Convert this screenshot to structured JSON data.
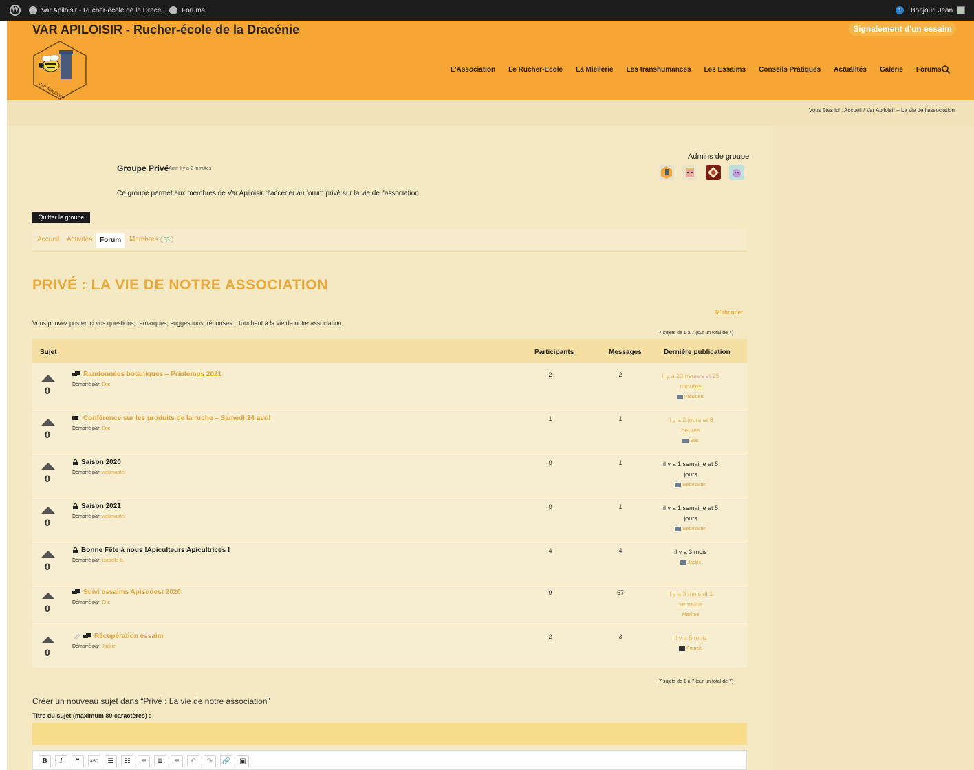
{
  "adminbar": {
    "site_name": "Var Apiloisir - Rucher-école de la Dracé...",
    "forums": "Forums",
    "notifications": "1",
    "greeting": "Bonjour, Jean"
  },
  "site": {
    "title": "VAR APILOISIR - Rucher-école de la Dracénie",
    "alert_button": "Signalement d'un essaim"
  },
  "nav": {
    "items": [
      "L'Association",
      "Le Rucher-Ecole",
      "La Miellerie",
      "Les transhumances",
      "Les Essaims",
      "Conseils Pratiques",
      "Actualités",
      "Galerie",
      "Forums"
    ]
  },
  "breadcrumb": {
    "text": "Vous êtes ici : Accueil / Var Apiloisir – La vie de l'association"
  },
  "group": {
    "name": "Groupe Privé",
    "active": "Actif il y a 2 minutes",
    "description": "Ce groupe permet aux membres de Var Apiloisir d'accéder au forum privé sur la vie de l'association",
    "admins_title": "Admins de groupe",
    "leave_button": "Quitter le groupe"
  },
  "tabs": {
    "home": "Accueil",
    "activity": "Activités",
    "forum": "Forum",
    "members": "Membres",
    "members_count": "53"
  },
  "forum": {
    "title": "PRIVÉ : LA VIE DE NOTRE ASSOCIATION",
    "subscribe": "M'abonner",
    "description": "Vous pouvez poster ici vos questions, remarques, suggestions, réponses... touchant à la vie de notre association.",
    "pagination": "7 sujets de 1 à 7 (sur un total de 7)"
  },
  "table": {
    "headers": {
      "topic": "Sujet",
      "participants": "Participants",
      "messages": "Messages",
      "last": "Dernière publication"
    },
    "started_by": "Démarré par:",
    "rows": [
      {
        "title": "Randonnées botaniques – Printemps 2021",
        "author": "Eric",
        "votes": "0",
        "participants": "2",
        "messages": "2",
        "last_l1": "il y a 23 heures et 25",
        "last_l2": "minutes",
        "last_author": "Président"
      },
      {
        "title": "Conférence sur les produits de la ruche – Samedi 24 avril",
        "author": "Eric",
        "votes": "0",
        "participants": "1",
        "messages": "1",
        "last_l1": "il y a 2 jours et 8",
        "last_l2": "heures",
        "last_author": "Eric"
      },
      {
        "title": "Saison 2020",
        "author": "webmaster",
        "votes": "0",
        "participants": "0",
        "messages": "1",
        "last_l1": "il y a 1 semaine et 5",
        "last_l2": "jours",
        "last_author": "webmaster"
      },
      {
        "title": "Saison 2021",
        "author": "webmaster",
        "votes": "0",
        "participants": "0",
        "messages": "1",
        "last_l1": "il y a 1 semaine et 5",
        "last_l2": "jours",
        "last_author": "webmaster"
      },
      {
        "title": "Bonne Fête à nous !Apiculteurs Apicultrices !",
        "author": "Isabelle B.",
        "votes": "0",
        "participants": "4",
        "messages": "4",
        "last_l1": "il y a 3 mois",
        "last_l2": "",
        "last_author": "Jackie"
      },
      {
        "title": "Suivi essaims Apisudest 2020",
        "author": "Eric",
        "votes": "0",
        "participants": "9",
        "messages": "57",
        "last_l1": "il y a 3 mois et 1",
        "last_l2": "semaine",
        "last_author": "Maxime"
      },
      {
        "title": "Récupération essaim",
        "author": "Jackie",
        "votes": "0",
        "participants": "2",
        "messages": "3",
        "last_l1": "il y a 5 mois",
        "last_l2": "",
        "last_author": "Francis"
      }
    ]
  },
  "new_topic": {
    "heading": "Créer un nouveau sujet dans “Privé : La vie de notre association”",
    "title_label": "Titre du sujet (maximum 80 caractères) :"
  },
  "toolbar": [
    "B",
    "I",
    "66",
    "ABC",
    "list-ul",
    "list-ol",
    "align-left",
    "align-center",
    "align-right",
    "undo",
    "redo",
    "link",
    "image"
  ],
  "colors": {
    "orange": "#f5a634",
    "accent": "#e8a83a",
    "cream": "#f5e9c4"
  }
}
